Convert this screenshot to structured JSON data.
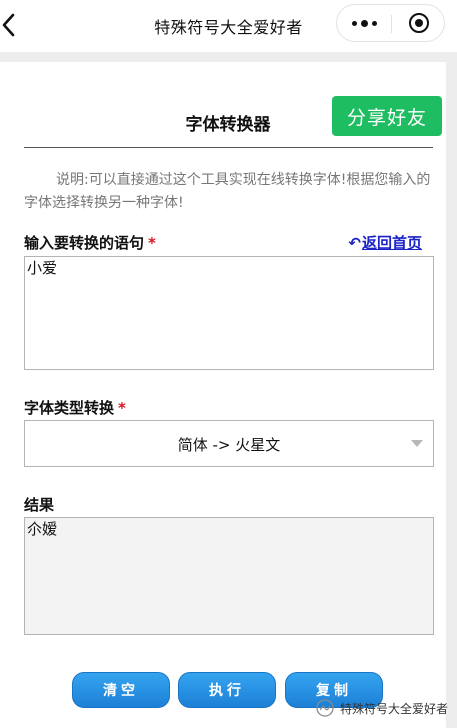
{
  "navbar": {
    "title": "特殊符号大全爱好者"
  },
  "header": {
    "share_label": "分享好友",
    "page_title": "字体转换器"
  },
  "description": "说明:可以直接通过这个工具实现在线转换字体!根据您输入的字体选择转换另一种字体!",
  "input_section": {
    "label": "输入要转换的语句",
    "required_mark": "*",
    "home_link_arrow": "↶",
    "home_link": "返回首页",
    "value": "小爱"
  },
  "font_type_section": {
    "label": "字体类型转换",
    "required_mark": "*",
    "selected": "简体 -> 火星文"
  },
  "result_section": {
    "label": "结果",
    "value": "尒嫒"
  },
  "actions": {
    "clear_label": "清空",
    "execute_label": "执行",
    "copy_label": "复制"
  },
  "watermark": {
    "text": "特殊符号大全爱好者"
  },
  "colors": {
    "share_button": "#1fbd61",
    "action_button": "#1c80d6",
    "required": "#d8141e",
    "link": "#1a22c8"
  }
}
